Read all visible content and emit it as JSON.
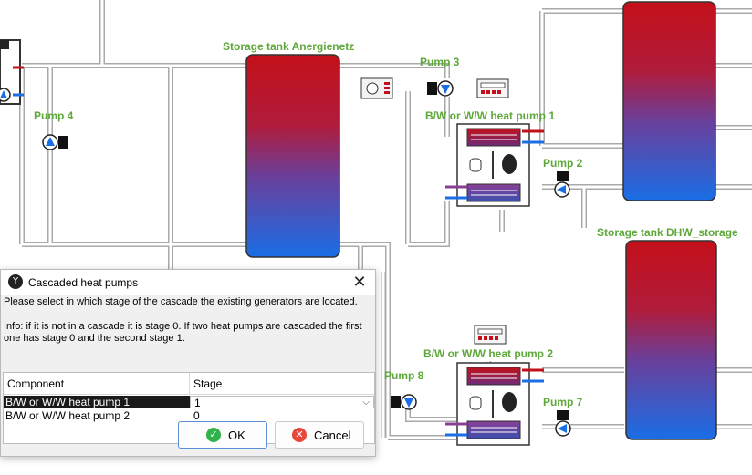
{
  "diagram": {
    "labels": {
      "storage_tank_anergienetz": "Storage tank Anergienetz",
      "storage_tank_dhw": "Storage tank DHW_storage",
      "pump_2": "Pump 2",
      "pump_3": "Pump 3",
      "pump_4": "Pump 4",
      "pump_7": "Pump 7",
      "pump_8": "Pump 8",
      "heat_pump_1": "B/W or W/W heat pump 1",
      "heat_pump_2": "B/W or W/W heat pump 2"
    },
    "colors": {
      "label_green": "#5ea83a",
      "tank_hot": "#c4101a",
      "tank_cold": "#1a6ee6",
      "pipe": "#c9c9c9"
    }
  },
  "dialog": {
    "title": "Cascaded heat pumps",
    "app_icon": "Y",
    "close_glyph": "✕",
    "message_1": "Please select in which stage of the cascade the existing generators are located.",
    "message_2": "Info: if it is not in a cascade it is stage 0. If two heat pumps are cascaded the first one has stage 0 and the second stage 1.",
    "table": {
      "headers": {
        "component": "Component",
        "stage": "Stage"
      },
      "rows": [
        {
          "component": "B/W or W/W heat pump 1",
          "stage": "1"
        },
        {
          "component": "B/W or W/W heat pump 2",
          "stage": "0"
        }
      ],
      "dropdown_arrow": "⌵"
    },
    "ok_label": "OK",
    "ok_icon": "✓",
    "cancel_label": "Cancel",
    "cancel_icon": "✕"
  }
}
